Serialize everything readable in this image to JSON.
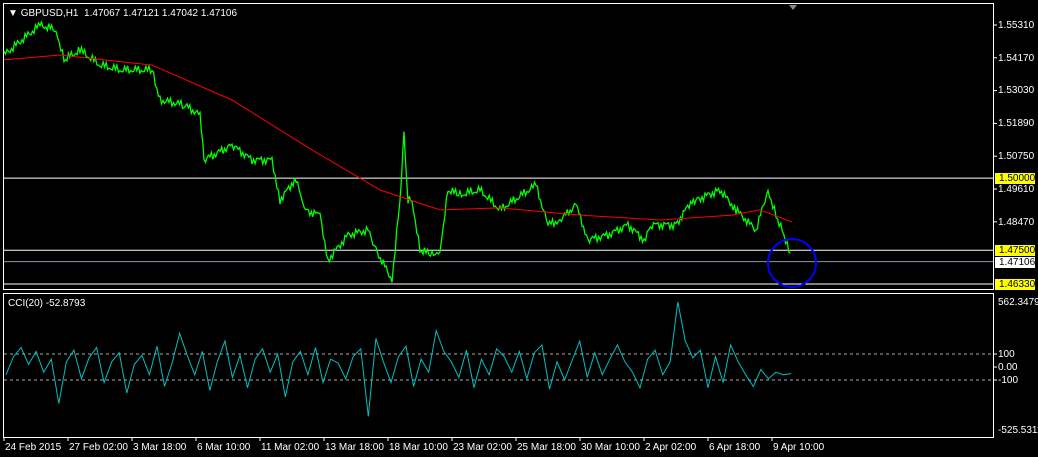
{
  "header": {
    "symbol": "GBPUSD,H1",
    "open": "1.47067",
    "high": "1.47121",
    "low": "1.47042",
    "close": "1.47106"
  },
  "price_axis": {
    "labels": [
      "1.55310",
      "1.54170",
      "1.53030",
      "1.51890",
      "1.50750",
      "1.49610",
      "1.48470"
    ],
    "top": 1.5531,
    "bottom": 1.4633
  },
  "levels": [
    {
      "label": "1.50000",
      "value": 1.5,
      "color": "#ffff00"
    },
    {
      "label": "1.47500",
      "value": 1.475,
      "color": "#ffff00"
    },
    {
      "label": "1.46330",
      "value": 1.4633,
      "color": "#ffff00"
    },
    {
      "label": "1.47106",
      "value": 1.47106,
      "color": "#ffffff"
    }
  ],
  "price_series": {
    "color": "#00ff00",
    "index": [
      0,
      4.5,
      6.5,
      7.5,
      9.5,
      12,
      14.5,
      18.5,
      19.5,
      22.5,
      24.5,
      25,
      28.5,
      31,
      33.5,
      34.5,
      36.5,
      37.5,
      39.5,
      40.5,
      43,
      45.5,
      46.5,
      48.5,
      49.5,
      50,
      50.5,
      51,
      52,
      53.5,
      54.5,
      55.5,
      57,
      59.5,
      62,
      66.5,
      68,
      69.5,
      71.5,
      73,
      75.5,
      78,
      80,
      81,
      84,
      86,
      86.5,
      89.5,
      91.5,
      94,
      95.5,
      96.5,
      97.5,
      98.5
    ],
    "values": [
      1.5427,
      1.5531,
      1.5514,
      1.541,
      1.5444,
      1.5392,
      1.5375,
      1.5375,
      1.5271,
      1.5254,
      1.5219,
      1.5063,
      1.5115,
      1.5063,
      1.5063,
      1.4924,
      1.5,
      1.489,
      1.4872,
      1.4716,
      1.4803,
      1.482,
      1.4751,
      1.4647,
      1.4924,
      1.515,
      1.4924,
      1.4924,
      1.4751,
      1.4734,
      1.4751,
      1.4959,
      1.4942,
      1.4959,
      1.489,
      1.4976,
      1.4838,
      1.4855,
      1.4907,
      1.4786,
      1.4803,
      1.4838,
      1.4786,
      1.4838,
      1.4838,
      1.4924,
      1.4924,
      1.4959,
      1.489,
      1.482,
      1.4959,
      1.4872,
      1.4803,
      1.4709
    ]
  },
  "ma_series": {
    "color": "#ff0000",
    "index": [
      0,
      7,
      18.5,
      28.5,
      38.5,
      47,
      54.5,
      62,
      72,
      82,
      91,
      94.5,
      98.5
    ],
    "values": [
      1.541,
      1.5427,
      1.5392,
      1.5271,
      1.5098,
      1.4959,
      1.489,
      1.4897,
      1.4872,
      1.4855,
      1.4872,
      1.489,
      1.4848
    ]
  },
  "cci": {
    "title": "CCI(20) -52.8793",
    "axis": {
      "max_label": "562.3479",
      "min_label": "-525.5311",
      "max": 562.3479,
      "min": -525.5311,
      "levels": [
        "100",
        "0.00",
        "-100"
      ]
    },
    "color": "#00c0c0",
    "values": [
      -60,
      80,
      150,
      20,
      120,
      -40,
      60,
      -280,
      40,
      130,
      -90,
      70,
      150,
      -120,
      40,
      110,
      -200,
      20,
      90,
      -60,
      160,
      -150,
      30,
      260,
      90,
      -60,
      120,
      -180,
      40,
      200,
      -80,
      90,
      -160,
      60,
      140,
      -40,
      100,
      -230,
      40,
      120,
      -60,
      150,
      -120,
      60,
      30,
      -90,
      80,
      140,
      -380,
      220,
      40,
      -120,
      80,
      160,
      -150,
      60,
      -40,
      280,
      120,
      40,
      -80,
      130,
      -160,
      60,
      -60,
      140,
      80,
      -40,
      120,
      -90,
      110,
      170,
      -170,
      40,
      -100,
      50,
      200,
      -80,
      110,
      -60,
      60,
      170,
      40,
      -40,
      -160,
      60,
      130,
      -60,
      40,
      500,
      200,
      70,
      130,
      -160,
      80,
      -120,
      170,
      40,
      -60,
      -150,
      -20,
      -90,
      -40,
      -60,
      -50
    ]
  },
  "time_axis": [
    "24 Feb 2015",
    "27 Feb 02:00",
    "3 Mar 18:00",
    "6 Mar 10:00",
    "11 Mar 02:00",
    "13 Mar 18:00",
    "18 Mar 10:00",
    "23 Mar 02:00",
    "25 Mar 18:00",
    "30 Mar 10:00",
    "2 Apr 02:00",
    "6 Apr 18:00",
    "9 Apr 10:00"
  ]
}
